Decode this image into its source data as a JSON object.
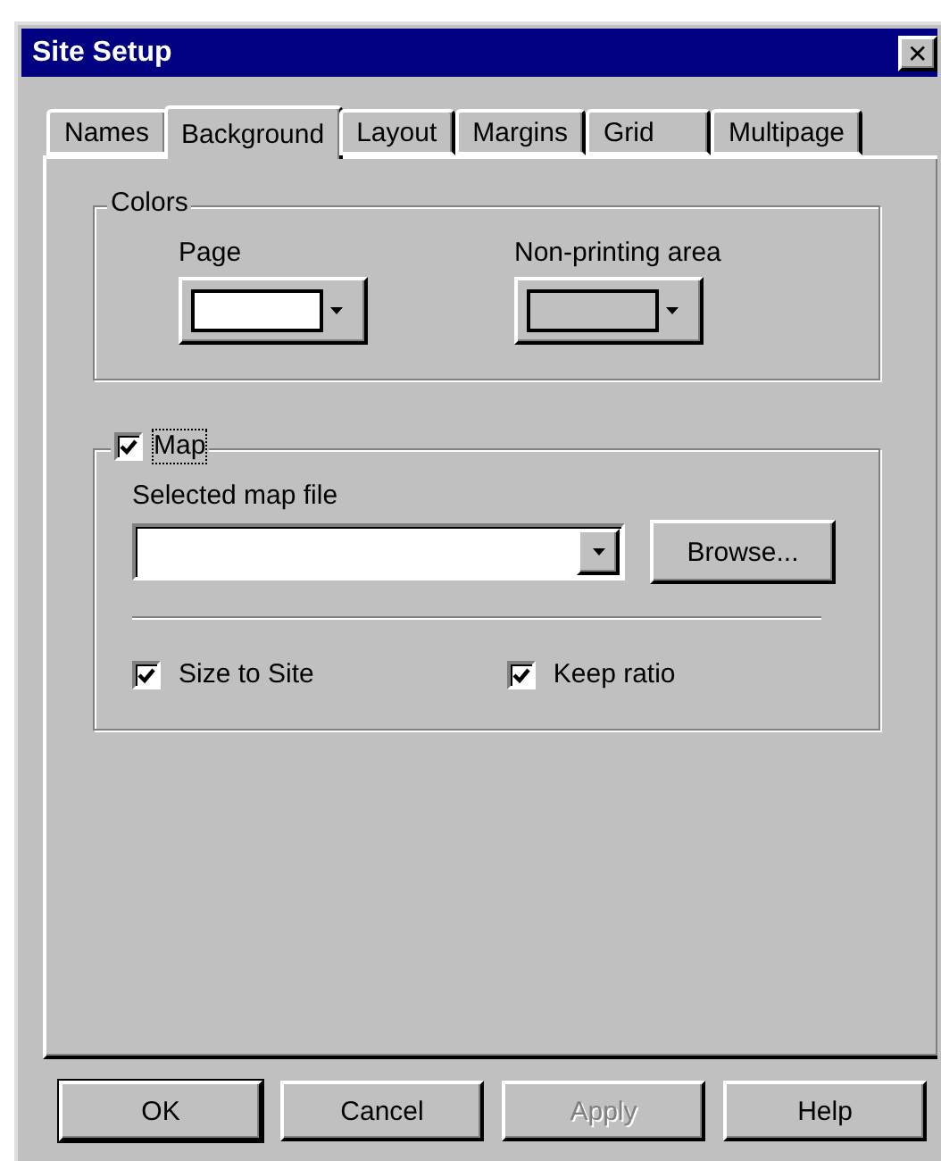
{
  "window": {
    "title": "Site Setup",
    "close": "✕"
  },
  "tabs": [
    {
      "label": "Names",
      "selected": false
    },
    {
      "label": "Background",
      "selected": true
    },
    {
      "label": "Layout",
      "selected": false
    },
    {
      "label": "Margins",
      "selected": false
    },
    {
      "label": "Grid",
      "selected": false
    },
    {
      "label": "Multipage",
      "selected": false
    }
  ],
  "colors_group": {
    "title": "Colors",
    "pickers": [
      {
        "label": "Page",
        "color": "#ffffff"
      },
      {
        "label": "Non-printing area",
        "color": "#c0c0c0"
      }
    ]
  },
  "map_group": {
    "title": "Map",
    "checked": true,
    "focused": true,
    "file_label": "Selected map file",
    "browse": "Browse...",
    "options": [
      {
        "label": "Size to Site",
        "checked": true
      },
      {
        "label": "Keep ratio",
        "checked": true
      }
    ]
  },
  "buttons": [
    {
      "label": "OK",
      "default": true,
      "disabled": false
    },
    {
      "label": "Cancel",
      "default": false,
      "disabled": false
    },
    {
      "label": "Apply",
      "default": false,
      "disabled": true
    },
    {
      "label": "Help",
      "default": false,
      "disabled": false
    }
  ]
}
